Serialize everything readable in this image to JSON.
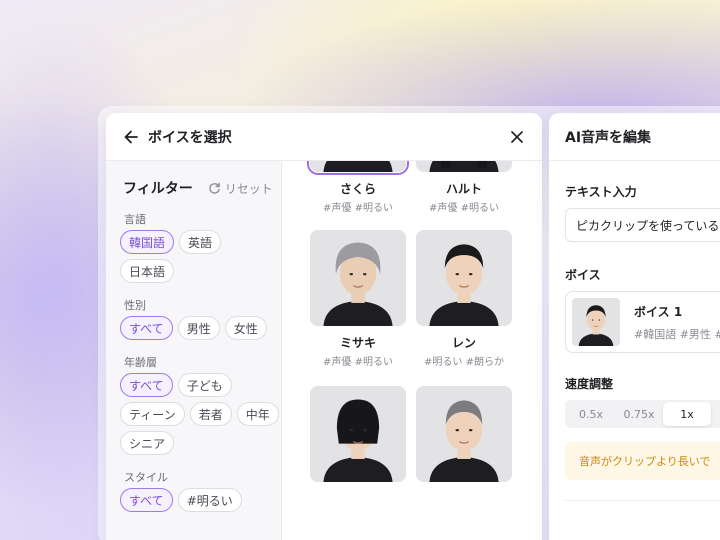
{
  "voice_panel": {
    "title": "ボイスを選択",
    "filter": {
      "title": "フィルター",
      "reset_label": "リセット",
      "groups": [
        {
          "label": "言語",
          "chips": [
            {
              "label": "韓国語",
              "active": true
            },
            {
              "label": "英語",
              "active": false
            },
            {
              "label": "日本語",
              "active": false
            }
          ]
        },
        {
          "label": "性別",
          "chips": [
            {
              "label": "すべて",
              "active": true
            },
            {
              "label": "男性",
              "active": false
            },
            {
              "label": "女性",
              "active": false
            }
          ]
        },
        {
          "label": "年齢層",
          "chips": [
            {
              "label": "すべて",
              "active": true
            },
            {
              "label": "子ども",
              "active": false
            },
            {
              "label": "ティーン",
              "active": false
            },
            {
              "label": "若者",
              "active": false
            },
            {
              "label": "中年",
              "active": false
            },
            {
              "label": "シニア",
              "active": false
            }
          ]
        },
        {
          "label": "スタイル",
          "chips": [
            {
              "label": "すべて",
              "active": true
            },
            {
              "label": "#明るい",
              "active": false
            }
          ]
        }
      ]
    },
    "voices": [
      {
        "name": "さくら",
        "tags": "#声優 #明るい",
        "selected": true,
        "portrait": "young-man"
      },
      {
        "name": "ハルト",
        "tags": "#声優 #明るい",
        "selected": false,
        "portrait": "girl"
      },
      {
        "name": "ミサキ",
        "tags": "#声優 #明るい",
        "selected": false,
        "portrait": "elderly-woman"
      },
      {
        "name": "レン",
        "tags": "#明るい #朗らか",
        "selected": false,
        "portrait": "boy"
      },
      {
        "name": "",
        "tags": "",
        "selected": false,
        "portrait": "woman-partial"
      },
      {
        "name": "",
        "tags": "",
        "selected": false,
        "portrait": "older-man-partial"
      }
    ]
  },
  "edit_panel": {
    "title": "AI音声を編集",
    "text_label": "テキスト入力",
    "text_value": "ピカクリップを使っている",
    "voice_label": "ボイス",
    "voice_name": "ボイス 1",
    "voice_tags": "#韓国語 #男性 #",
    "speed_label": "速度調整",
    "speeds": [
      {
        "label": "0.5x",
        "active": false
      },
      {
        "label": "0.75x",
        "active": false
      },
      {
        "label": "1x",
        "active": true
      }
    ],
    "notice": "音声がクリップより長いで"
  },
  "colors": {
    "accent": "#9f6ee8",
    "notice_text": "#c98a12",
    "notice_bg": "#fff7e6"
  }
}
